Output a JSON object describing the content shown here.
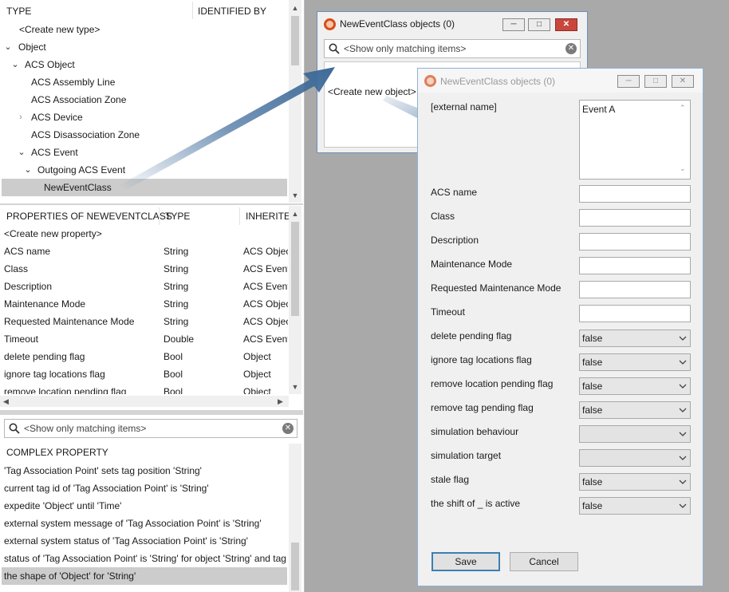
{
  "type_tree": {
    "header_type": "TYPE",
    "header_identified_by": "IDENTIFIED BY",
    "items": [
      "<Create new type>",
      "Object",
      "ACS Object",
      "ACS Assembly Line",
      "ACS Association Zone",
      "ACS Device",
      "ACS Disassociation Zone",
      "ACS Event",
      "Outgoing ACS Event",
      "NewEventClass"
    ]
  },
  "properties": {
    "header_name": "PROPERTIES OF NEWEVENTCLASS",
    "header_type": "TYPE",
    "header_inherited": "INHERITED",
    "create_label": "<Create new property>",
    "rows": [
      {
        "name": "ACS name",
        "type": "String",
        "inherited": "ACS Objec"
      },
      {
        "name": "Class",
        "type": "String",
        "inherited": "ACS Event"
      },
      {
        "name": "Description",
        "type": "String",
        "inherited": "ACS Event"
      },
      {
        "name": "Maintenance Mode",
        "type": "String",
        "inherited": "ACS Objec"
      },
      {
        "name": "Requested Maintenance Mode",
        "type": "String",
        "inherited": "ACS Objec"
      },
      {
        "name": "Timeout",
        "type": "Double",
        "inherited": "ACS Event"
      },
      {
        "name": "delete pending flag",
        "type": "Bool",
        "inherited": "Object"
      },
      {
        "name": "ignore tag locations flag",
        "type": "Bool",
        "inherited": "Object"
      },
      {
        "name": "remove location pending flag",
        "type": "Bool",
        "inherited": "Object"
      }
    ]
  },
  "complex": {
    "search_placeholder": "<Show only matching items>",
    "header": "COMPLEX PROPERTY",
    "rows": [
      "'Tag Association Point' sets tag position 'String'",
      "current tag id of 'Tag Association Point' is 'String'",
      "expedite 'Object' until 'Time'",
      "external system message of 'Tag Association Point' is 'String'",
      "external system status of 'Tag Association Point' is 'String'",
      "status of 'Tag Association Point' is 'String' for object 'String' and tag",
      "the shape of 'Object' for 'String'"
    ]
  },
  "objects_window": {
    "title": "NewEventClass objects (0)",
    "search_placeholder": "<Show only matching items>",
    "create_label": "<Create new object>"
  },
  "form_window": {
    "title": "NewEventClass objects (0)",
    "external_name_label": "[external name]",
    "external_name_value": "Event A",
    "text_fields": [
      {
        "label": "ACS name",
        "value": ""
      },
      {
        "label": "Class",
        "value": ""
      },
      {
        "label": "Description",
        "value": ""
      },
      {
        "label": "Maintenance Mode",
        "value": ""
      },
      {
        "label": "Requested Maintenance Mode",
        "value": ""
      },
      {
        "label": "Timeout",
        "value": ""
      }
    ],
    "select_fields": [
      {
        "label": "delete pending flag",
        "value": "false"
      },
      {
        "label": "ignore tag locations flag",
        "value": "false"
      },
      {
        "label": "remove location pending flag",
        "value": "false"
      },
      {
        "label": "remove tag pending flag",
        "value": "false"
      },
      {
        "label": "simulation behaviour",
        "value": ""
      },
      {
        "label": "simulation target",
        "value": ""
      },
      {
        "label": "stale flag",
        "value": "false"
      },
      {
        "label": "the shift of _ is active",
        "value": "false"
      }
    ],
    "save_label": "Save",
    "cancel_label": "Cancel"
  },
  "colors": {
    "workspace": "#a9a9a9",
    "selection": "#cccccc",
    "arrow": "#3e6a99",
    "window_border": "#6e8fb5"
  }
}
